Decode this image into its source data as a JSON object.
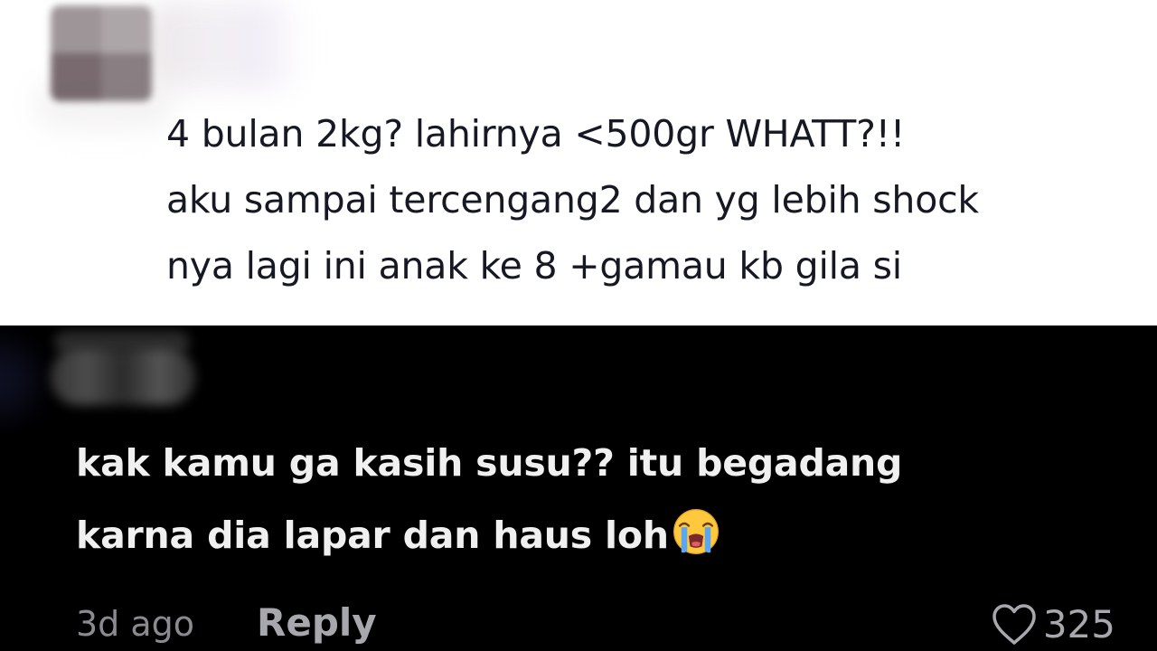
{
  "comment": {
    "lines": [
      "4 bulan 2kg? lahirnya <500gr WHATT?!!",
      "aku sampai tercengang2 dan yg lebih shock",
      "nya lagi ini anak ke 8 +gamau kb gila si"
    ]
  },
  "reply": {
    "lines": [
      "kak kamu ga kasih susu?? itu begadang",
      "karna dia lapar dan haus loh"
    ],
    "emoji": "loudly-crying-face",
    "time": "3d ago",
    "reply_label": "Reply",
    "like_icon": "heart-outline-icon",
    "like_count": "325"
  },
  "colors": {
    "light_bg": "#ffffff",
    "dark_bg": "#000000",
    "light_text": "#161823",
    "dark_text": "#f0f0f0",
    "meta_text": "#8a8b91"
  }
}
